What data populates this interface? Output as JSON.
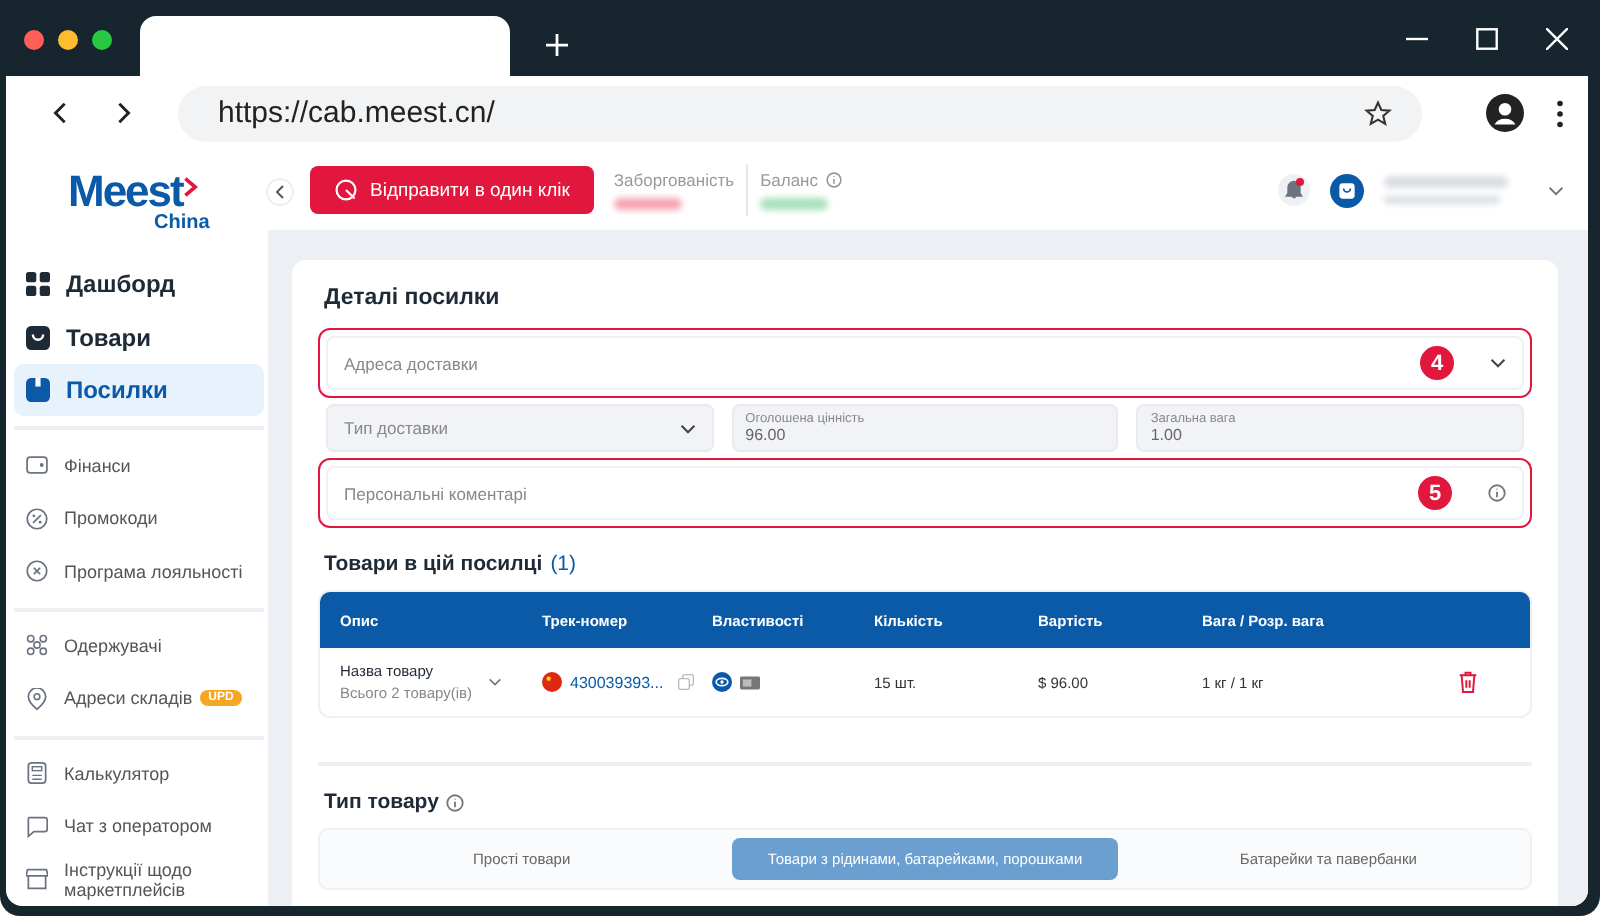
{
  "browser": {
    "url": "https://cab.meest.cn/"
  },
  "logo": {
    "name": "Meest",
    "sub": "China"
  },
  "header": {
    "send_button": "Відправити в один клік",
    "debt_label": "Заборгованість",
    "balance_label": "Баланс",
    "notifications_unread": true
  },
  "sidebar": {
    "groups": [
      [
        {
          "label": "Дашборд",
          "kind": "main",
          "selected": false
        },
        {
          "label": "Товари",
          "kind": "main",
          "selected": false
        },
        {
          "label": "Посилки",
          "kind": "main",
          "selected": true
        }
      ],
      [
        {
          "label": "Фінанси",
          "kind": "sub",
          "selected": false
        },
        {
          "label": "Промокоди",
          "kind": "sub",
          "selected": false
        },
        {
          "label": "Програма лояльності",
          "kind": "sub",
          "selected": false
        }
      ],
      [
        {
          "label": "Одержувачі",
          "kind": "sub",
          "selected": false
        },
        {
          "label": "Адреси складів",
          "kind": "sub",
          "selected": false,
          "badge": "UPD"
        }
      ],
      [
        {
          "label": "Калькулятор",
          "kind": "sub",
          "selected": false
        },
        {
          "label": "Чат з оператором",
          "kind": "sub",
          "selected": false
        },
        {
          "label": "Інструкції щодо маркетплейсів",
          "kind": "sub",
          "selected": false
        }
      ]
    ]
  },
  "card": {
    "title": "Деталі посилки",
    "address": {
      "placeholder": "Адреса доставки",
      "callout": "4"
    },
    "delivery_type": {
      "placeholder": "Тип доставки"
    },
    "declared_value": {
      "label": "Оголошена цінність",
      "value": "96.00"
    },
    "total_weight": {
      "label": "Загальна вага",
      "value": "1.00"
    },
    "comments": {
      "placeholder": "Персональні коментарі",
      "callout": "5"
    },
    "items_title": "Товари в цій посилці",
    "items_count": "(1)",
    "table": {
      "columns": [
        "Опис",
        "Трек-номер",
        "Властивості",
        "Кількість",
        "Вартість",
        "Вага / Розр. вага"
      ],
      "rows": [
        {
          "name": "Назва товару",
          "total": "Всього 2 товару(ів)",
          "tracking": "430039393...",
          "quantity": "15 шт.",
          "price": "$ 96.00",
          "weight": "1 кг / 1 кг"
        }
      ]
    },
    "product_type_title": "Тип товару",
    "product_types": [
      {
        "label": "Прості товари",
        "selected": false
      },
      {
        "label": "Товари з рідинами, батарейками, порошками",
        "selected": true
      },
      {
        "label": "Батарейки та павербанки",
        "selected": false
      }
    ]
  }
}
